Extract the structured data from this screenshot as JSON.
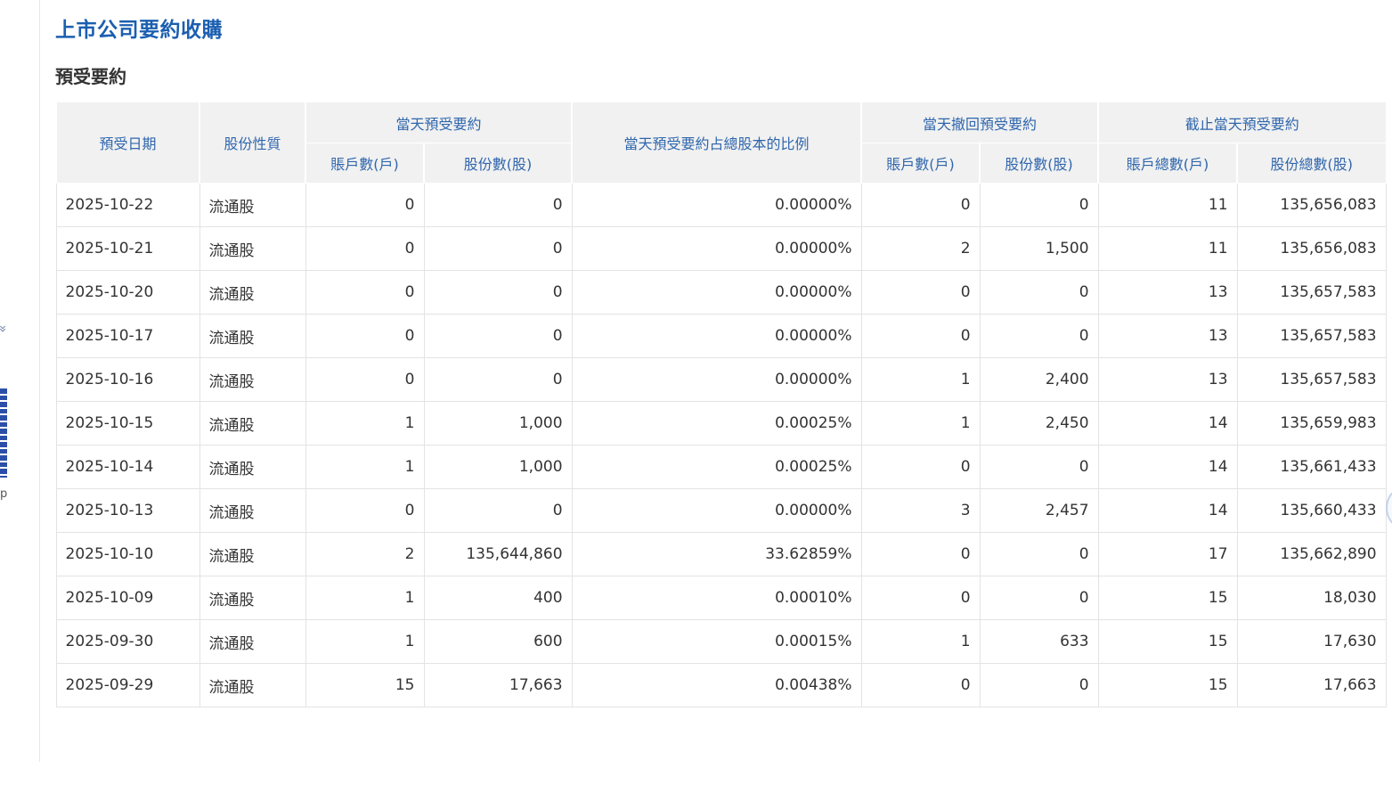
{
  "page": {
    "title": "上市公司要約收購",
    "section_title": "預受要約"
  },
  "sidebar": {
    "chevron_glyph": "«",
    "letter": "p"
  },
  "table": {
    "headers": {
      "date": "預受日期",
      "share_type": "股份性質",
      "day_accept_group": "當天預受要約",
      "day_accept_accounts": "賬戶數(戶)",
      "day_accept_shares": "股份數(股)",
      "ratio": "當天預受要約占總股本的比例",
      "withdraw_group": "當天撤回預受要約",
      "withdraw_accounts": "賬戶數(戶)",
      "withdraw_shares": "股份數(股)",
      "cumulative_group": "截止當天預受要約",
      "cumulative_accounts": "賬戶總數(戶)",
      "cumulative_shares": "股份總數(股)"
    },
    "rows": [
      {
        "date": "2025-10-22",
        "type": "流通股",
        "acc": "0",
        "shares": "0",
        "ratio": "0.00000%",
        "w_acc": "0",
        "w_shares": "0",
        "c_acc": "11",
        "c_shares": "135,656,083"
      },
      {
        "date": "2025-10-21",
        "type": "流通股",
        "acc": "0",
        "shares": "0",
        "ratio": "0.00000%",
        "w_acc": "2",
        "w_shares": "1,500",
        "c_acc": "11",
        "c_shares": "135,656,083"
      },
      {
        "date": "2025-10-20",
        "type": "流通股",
        "acc": "0",
        "shares": "0",
        "ratio": "0.00000%",
        "w_acc": "0",
        "w_shares": "0",
        "c_acc": "13",
        "c_shares": "135,657,583"
      },
      {
        "date": "2025-10-17",
        "type": "流通股",
        "acc": "0",
        "shares": "0",
        "ratio": "0.00000%",
        "w_acc": "0",
        "w_shares": "0",
        "c_acc": "13",
        "c_shares": "135,657,583"
      },
      {
        "date": "2025-10-16",
        "type": "流通股",
        "acc": "0",
        "shares": "0",
        "ratio": "0.00000%",
        "w_acc": "1",
        "w_shares": "2,400",
        "c_acc": "13",
        "c_shares": "135,657,583"
      },
      {
        "date": "2025-10-15",
        "type": "流通股",
        "acc": "1",
        "shares": "1,000",
        "ratio": "0.00025%",
        "w_acc": "1",
        "w_shares": "2,450",
        "c_acc": "14",
        "c_shares": "135,659,983"
      },
      {
        "date": "2025-10-14",
        "type": "流通股",
        "acc": "1",
        "shares": "1,000",
        "ratio": "0.00025%",
        "w_acc": "0",
        "w_shares": "0",
        "c_acc": "14",
        "c_shares": "135,661,433"
      },
      {
        "date": "2025-10-13",
        "type": "流通股",
        "acc": "0",
        "shares": "0",
        "ratio": "0.00000%",
        "w_acc": "3",
        "w_shares": "2,457",
        "c_acc": "14",
        "c_shares": "135,660,433"
      },
      {
        "date": "2025-10-10",
        "type": "流通股",
        "acc": "2",
        "shares": "135,644,860",
        "ratio": "33.62859%",
        "w_acc": "0",
        "w_shares": "0",
        "c_acc": "17",
        "c_shares": "135,662,890"
      },
      {
        "date": "2025-10-09",
        "type": "流通股",
        "acc": "1",
        "shares": "400",
        "ratio": "0.00010%",
        "w_acc": "0",
        "w_shares": "0",
        "c_acc": "15",
        "c_shares": "18,030"
      },
      {
        "date": "2025-09-30",
        "type": "流通股",
        "acc": "1",
        "shares": "600",
        "ratio": "0.00015%",
        "w_acc": "1",
        "w_shares": "633",
        "c_acc": "15",
        "c_shares": "17,630"
      },
      {
        "date": "2025-09-29",
        "type": "流通股",
        "acc": "15",
        "shares": "17,663",
        "ratio": "0.00438%",
        "w_acc": "0",
        "w_shares": "0",
        "c_acc": "15",
        "c_shares": "17,663"
      }
    ]
  }
}
